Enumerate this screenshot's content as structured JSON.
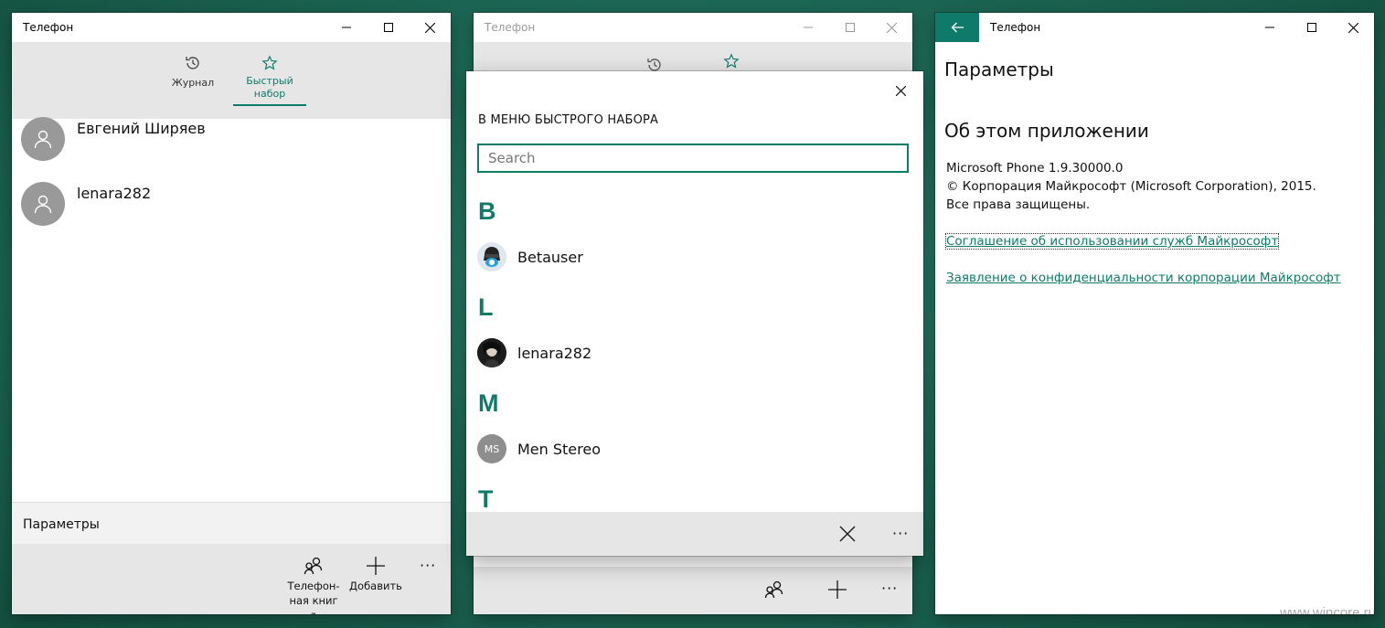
{
  "window1": {
    "title": "Телефон",
    "tabs": [
      {
        "label": "Журнал",
        "icon": "history-icon",
        "active": false
      },
      {
        "label": "Быстрый набор",
        "icon": "star-icon",
        "active": true
      }
    ],
    "contacts": [
      {
        "name": "Евгений Ширяев"
      },
      {
        "name": "lenara282"
      }
    ],
    "params_label": "Параметры",
    "commands": [
      {
        "label": "Телефон-ная книга",
        "icon": "contacts-icon"
      },
      {
        "label": "Добавить",
        "icon": "plus-icon"
      }
    ],
    "more": "···"
  },
  "window2": {
    "title": "Телефон",
    "more": "···"
  },
  "dialog": {
    "heading": "В МЕНЮ БЫСТРОГО НАБОРА",
    "search_placeholder": "Search",
    "groups": [
      {
        "letter": "B",
        "contacts": [
          {
            "name": "Betauser"
          }
        ]
      },
      {
        "letter": "L",
        "contacts": [
          {
            "name": "lenara282"
          }
        ]
      },
      {
        "letter": "M",
        "contacts": [
          {
            "name": "Men Stereo",
            "initials": "MS"
          }
        ]
      },
      {
        "letter": "T",
        "contacts": []
      }
    ],
    "more": "···"
  },
  "window3": {
    "title": "Телефон",
    "settings_title": "Параметры",
    "about_title": "Об этом приложении",
    "version": "Microsoft Phone 1.9.30000.0",
    "copyright": "© Корпорация Майкрософт (Microsoft Corporation), 2015.",
    "rights": "Все права защищены.",
    "link_terms": "Соглашение об использовании служб Майкрософт",
    "link_privacy": "Заявление о конфиденциальности корпорации Майкрософт"
  },
  "watermark": "www.wincore.ru",
  "colors": {
    "accent": "#0f7a6a",
    "desktop": "#1f6e5b"
  }
}
